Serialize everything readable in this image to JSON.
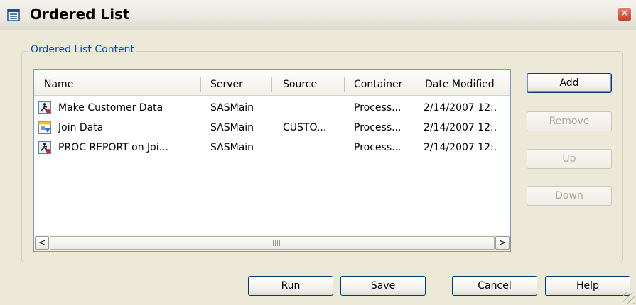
{
  "window": {
    "title": "Ordered List",
    "close_label": "✕"
  },
  "group": {
    "label": "Ordered List Content"
  },
  "table": {
    "columns": [
      "Name",
      "Server",
      "Source",
      "Container",
      "Date Modified"
    ],
    "rows": [
      {
        "icon": "job-run-icon",
        "name": "Make Customer Data",
        "server": "SASMain",
        "source": "",
        "container": "Process...",
        "date": "2/14/2007 12:."
      },
      {
        "icon": "join-data-icon",
        "name": "Join Data",
        "server": "SASMain",
        "source": "CUSTO...",
        "container": "Process...",
        "date": "2/14/2007 12:."
      },
      {
        "icon": "job-run-icon",
        "name": "PROC REPORT on Joi...",
        "server": "SASMain",
        "source": "",
        "container": "Process...",
        "date": "2/14/2007 12:."
      }
    ]
  },
  "scroll": {
    "left_arrow": "<",
    "right_arrow": ">"
  },
  "side_buttons": {
    "add": "Add",
    "remove": "Remove",
    "up": "Up",
    "down": "Down"
  },
  "footer_buttons": {
    "run": "Run",
    "save": "Save",
    "cancel": "Cancel",
    "help": "Help"
  },
  "colors": {
    "dialog_bg": "#ECE9D8",
    "group_label": "#0046d5",
    "close_red": "#c8402a"
  }
}
